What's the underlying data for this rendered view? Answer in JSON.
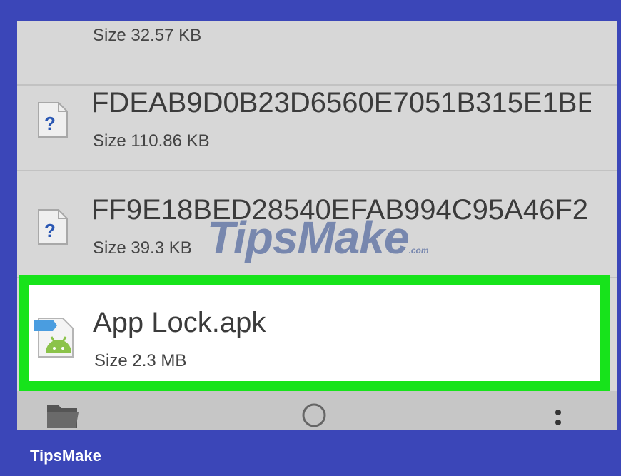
{
  "files": [
    {
      "name": "",
      "size": "Size 32.57 KB",
      "icon": "unknown-file-icon"
    },
    {
      "name": "FDEAB9D0B23D6560E7051B315E1BE",
      "size": "Size 110.86 KB",
      "icon": "unknown-file-icon"
    },
    {
      "name": "FF9E18BED28540EFAB994C95A46F2",
      "size": "Size 39.3 KB",
      "icon": "unknown-file-icon"
    }
  ],
  "selected_file": {
    "name": "App Lock.apk",
    "size": "Size 2.3 MB",
    "icon": "android-apk-icon",
    "highlight_color": "#17e31b"
  },
  "nav_bar": {
    "buttons": [
      "folder-icon",
      "home-circle-icon",
      "more-vertical-icon"
    ]
  },
  "watermark": {
    "text": "TipsMake",
    "suffix": ".com"
  },
  "brand": {
    "label": "TipsMake"
  },
  "colors": {
    "frame": "#3b46b8",
    "panel": "#d7d7d7",
    "highlight": "#17e31b"
  }
}
